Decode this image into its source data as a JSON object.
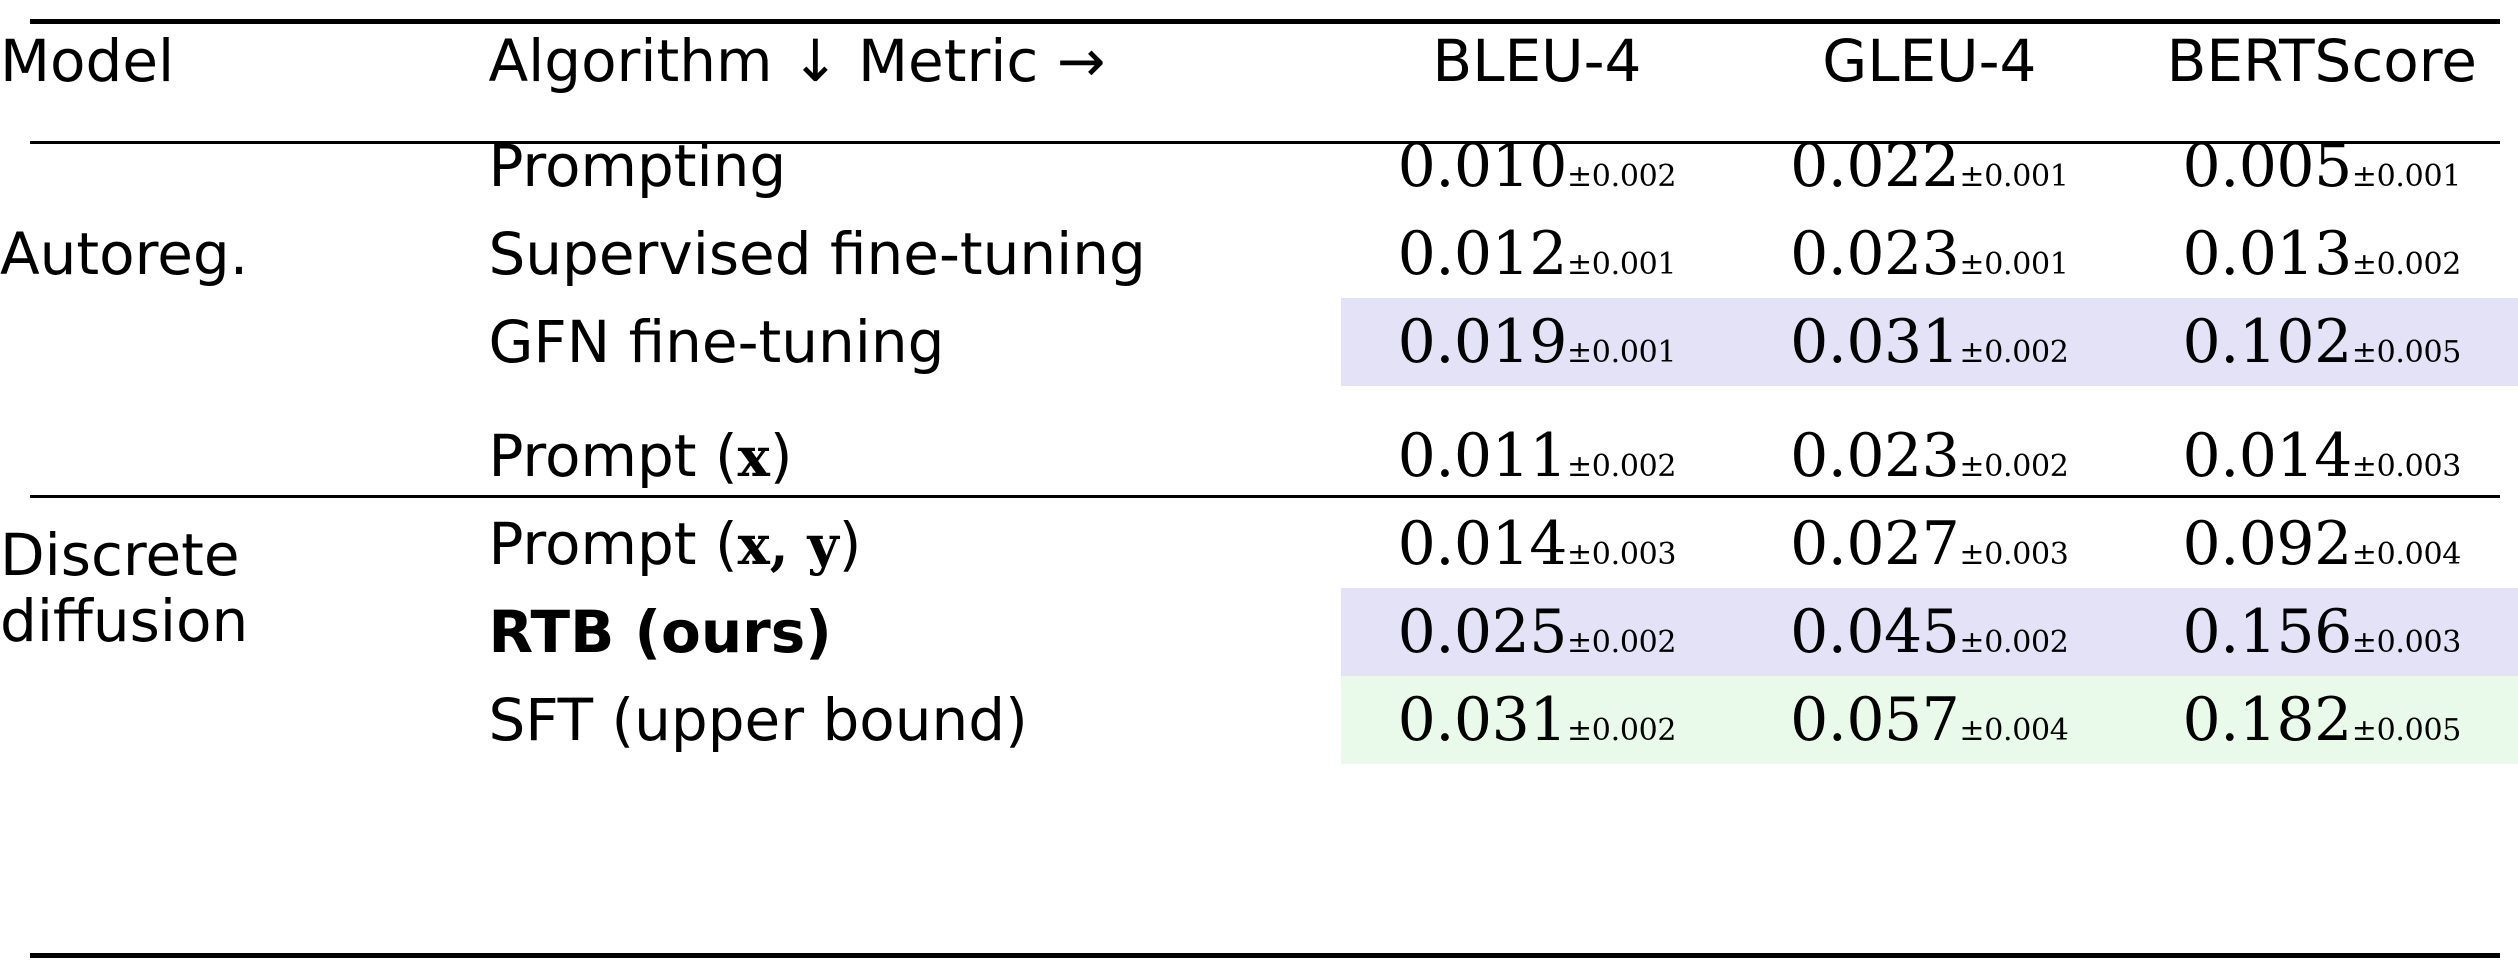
{
  "table": {
    "headers": {
      "model": "Model",
      "algorithm_metric": "Algorithm ↓ Metric →",
      "metrics": [
        "BLEU-4",
        "GLEU-4",
        "BERTScore"
      ]
    },
    "groups": [
      {
        "model": "Autoreg.",
        "rows": [
          {
            "algorithm": "Prompting",
            "bold": false,
            "highlight": "none",
            "values": [
              {
                "mean": "0.010",
                "err": "±0.002"
              },
              {
                "mean": "0.022",
                "err": "±0.001"
              },
              {
                "mean": "0.005",
                "err": "±0.001"
              }
            ]
          },
          {
            "algorithm": "Supervised fine-tuning",
            "bold": false,
            "highlight": "none",
            "values": [
              {
                "mean": "0.012",
                "err": "±0.001"
              },
              {
                "mean": "0.023",
                "err": "±0.001"
              },
              {
                "mean": "0.013",
                "err": "±0.002"
              }
            ]
          },
          {
            "algorithm": "GFN fine-tuning",
            "bold": false,
            "highlight": "blue",
            "values": [
              {
                "mean": "0.019",
                "err": "±0.001"
              },
              {
                "mean": "0.031",
                "err": "±0.002"
              },
              {
                "mean": "0.102",
                "err": "±0.005"
              }
            ]
          }
        ]
      },
      {
        "model": "Discrete diffusion",
        "model_line1": "Discrete",
        "model_line2": "diffusion",
        "rows": [
          {
            "algorithm": "Prompt (x)",
            "algorithm_prefix": "Prompt (",
            "algorithm_var": "x",
            "algorithm_suffix": ")",
            "bold": false,
            "highlight": "none",
            "values": [
              {
                "mean": "0.011",
                "err": "±0.002"
              },
              {
                "mean": "0.023",
                "err": "±0.002"
              },
              {
                "mean": "0.014",
                "err": "±0.003"
              }
            ]
          },
          {
            "algorithm": "Prompt (x, y)",
            "algorithm_prefix": "Prompt (",
            "algorithm_var": "x, y",
            "algorithm_suffix": ")",
            "bold": false,
            "highlight": "none",
            "values": [
              {
                "mean": "0.014",
                "err": "±0.003"
              },
              {
                "mean": "0.027",
                "err": "±0.003"
              },
              {
                "mean": "0.092",
                "err": "±0.004"
              }
            ]
          },
          {
            "algorithm": "RTB (ours)",
            "bold": true,
            "highlight": "blue",
            "values": [
              {
                "mean": "0.025",
                "err": "±0.002"
              },
              {
                "mean": "0.045",
                "err": "±0.002"
              },
              {
                "mean": "0.156",
                "err": "±0.003"
              }
            ]
          },
          {
            "algorithm": "SFT (upper bound)",
            "bold": false,
            "highlight": "green",
            "values": [
              {
                "mean": "0.031",
                "err": "±0.002"
              },
              {
                "mean": "0.057",
                "err": "±0.004"
              },
              {
                "mean": "0.182",
                "err": "±0.005"
              }
            ]
          }
        ]
      }
    ],
    "colors": {
      "highlight_blue": "#e3e2f7",
      "highlight_green": "#eafaea",
      "rule": "#000000",
      "text": "#000000"
    }
  },
  "chart_data": {
    "type": "table",
    "title": "",
    "columns": [
      "Model",
      "Algorithm",
      "BLEU-4",
      "GLEU-4",
      "BERTScore"
    ],
    "rows": [
      {
        "Model": "Autoreg.",
        "Algorithm": "Prompting",
        "BLEU-4": 0.01,
        "BLEU-4_err": 0.002,
        "GLEU-4": 0.022,
        "GLEU-4_err": 0.001,
        "BERTScore": 0.005,
        "BERTScore_err": 0.001
      },
      {
        "Model": "Autoreg.",
        "Algorithm": "Supervised fine-tuning",
        "BLEU-4": 0.012,
        "BLEU-4_err": 0.001,
        "GLEU-4": 0.023,
        "GLEU-4_err": 0.001,
        "BERTScore": 0.013,
        "BERTScore_err": 0.002
      },
      {
        "Model": "Autoreg.",
        "Algorithm": "GFN fine-tuning",
        "BLEU-4": 0.019,
        "BLEU-4_err": 0.001,
        "GLEU-4": 0.031,
        "GLEU-4_err": 0.002,
        "BERTScore": 0.102,
        "BERTScore_err": 0.005
      },
      {
        "Model": "Discrete diffusion",
        "Algorithm": "Prompt (x)",
        "BLEU-4": 0.011,
        "BLEU-4_err": 0.002,
        "GLEU-4": 0.023,
        "GLEU-4_err": 0.002,
        "BERTScore": 0.014,
        "BERTScore_err": 0.003
      },
      {
        "Model": "Discrete diffusion",
        "Algorithm": "Prompt (x, y)",
        "BLEU-4": 0.014,
        "BLEU-4_err": 0.003,
        "GLEU-4": 0.027,
        "GLEU-4_err": 0.003,
        "BERTScore": 0.092,
        "BERTScore_err": 0.004
      },
      {
        "Model": "Discrete diffusion",
        "Algorithm": "RTB (ours)",
        "BLEU-4": 0.025,
        "BLEU-4_err": 0.002,
        "GLEU-4": 0.045,
        "GLEU-4_err": 0.002,
        "BERTScore": 0.156,
        "BERTScore_err": 0.003
      },
      {
        "Model": "Discrete diffusion",
        "Algorithm": "SFT (upper bound)",
        "BLEU-4": 0.031,
        "BLEU-4_err": 0.002,
        "GLEU-4": 0.057,
        "GLEU-4_err": 0.004,
        "BERTScore": 0.182,
        "BERTScore_err": 0.005
      }
    ]
  }
}
